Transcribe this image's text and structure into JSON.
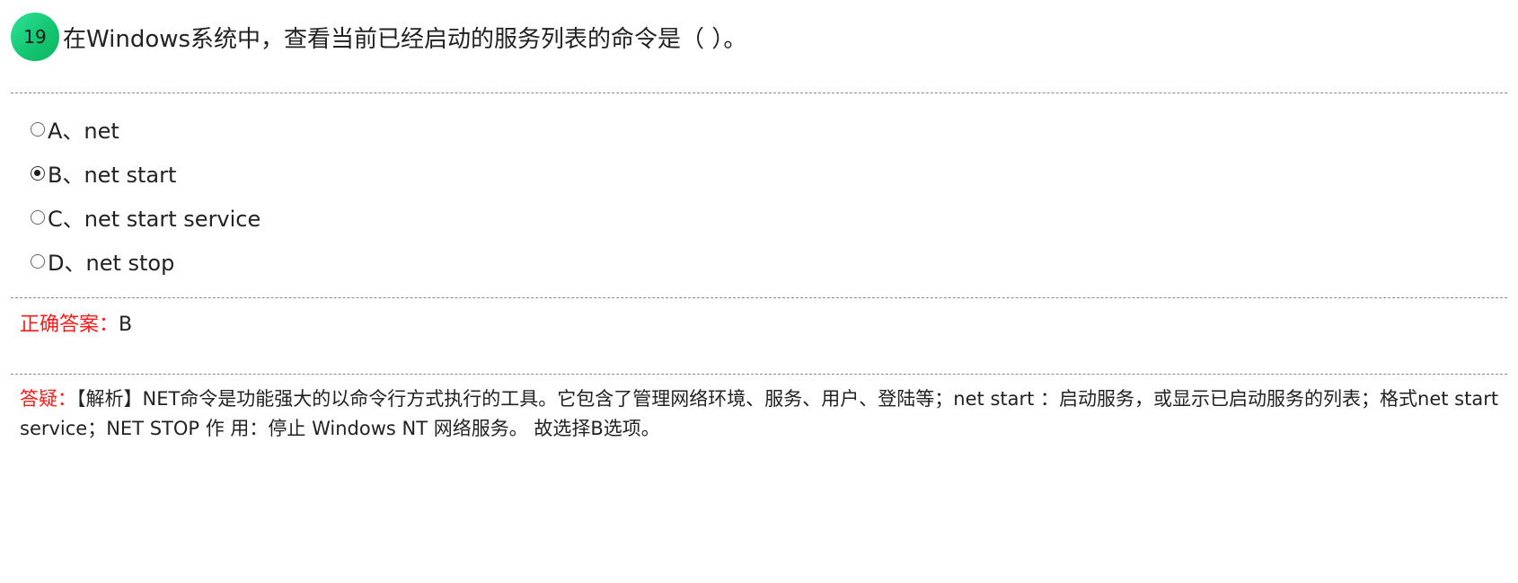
{
  "question": {
    "number": "19",
    "text": "在Windows系统中，查看当前已经启动的服务列表的命令是（ ）。"
  },
  "options": [
    {
      "label": "A、net",
      "checked": false
    },
    {
      "label": "B、net start",
      "checked": true
    },
    {
      "label": "C、net start service",
      "checked": false
    },
    {
      "label": "D、net stop",
      "checked": false
    }
  ],
  "answer": {
    "label": "正确答案：",
    "value": "B"
  },
  "analysis": {
    "label": "答疑：",
    "text": "【解析】NET命令是功能强大的以命令行方式执行的工具。它包含了管理网络环境、服务、用户、登陆等；net start ：启动服务，或显示已启动服务的列表；格式net start service；NET STOP 作 用：停止 Windows NT 网络服务。 故选择B选项。"
  }
}
